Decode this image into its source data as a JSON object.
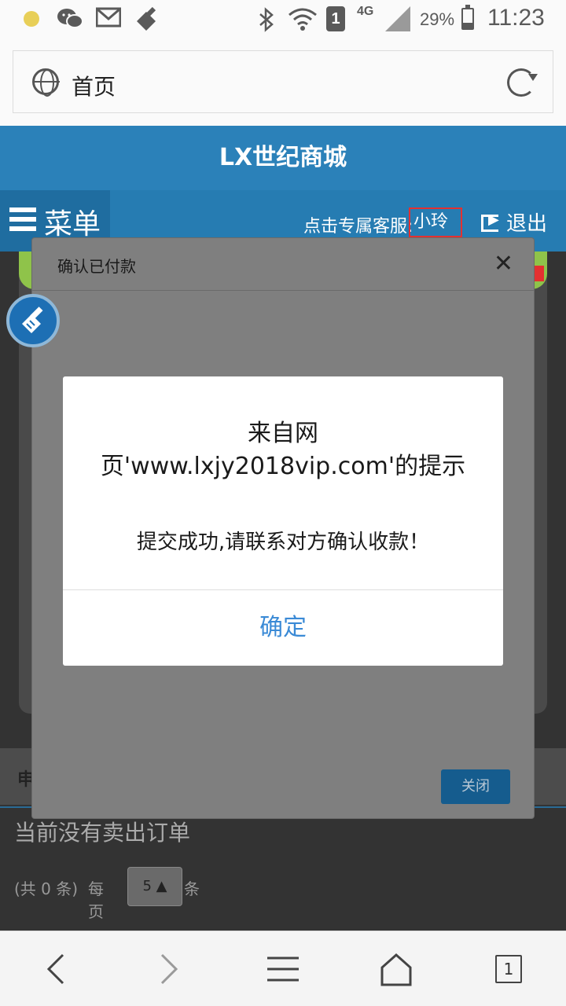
{
  "status_bar": {
    "notification_icons": [
      "circle-dot-icon",
      "wechat-icon",
      "mail-icon",
      "brush-icon"
    ],
    "network_type": "4G",
    "sim_slot": "1",
    "battery_percent": "29%",
    "battery_level": 0.29,
    "time": "11:23"
  },
  "address_bar": {
    "page_title": "首页"
  },
  "site": {
    "name": "LX世纪商城",
    "menu_label": "菜单",
    "service_prompt": "点击专属客服:",
    "service_name": "小玲",
    "logout_label": "退出"
  },
  "orders": {
    "empty_message": "当前没有卖出订单",
    "total_label": "(共 0 条)",
    "per_page_label": "每页",
    "per_page_value": "5",
    "unit_label": "条",
    "tab_partial_label": "申"
  },
  "page_modal": {
    "title": "确认已付款",
    "close_button_label": "关闭"
  },
  "alert_dialog": {
    "title": "来自网页'www.lxjy2018vip.com'的提示",
    "message": "提交成功,请联系对方确认收款！",
    "ok_label": "确定"
  },
  "bottom_bar": {
    "tab_count": "1"
  },
  "colors": {
    "header_blue": "#2b81b9",
    "accent_blue": "#3a8ad6",
    "status_green": "#8fc34a",
    "highlight_red": "#e43030"
  }
}
